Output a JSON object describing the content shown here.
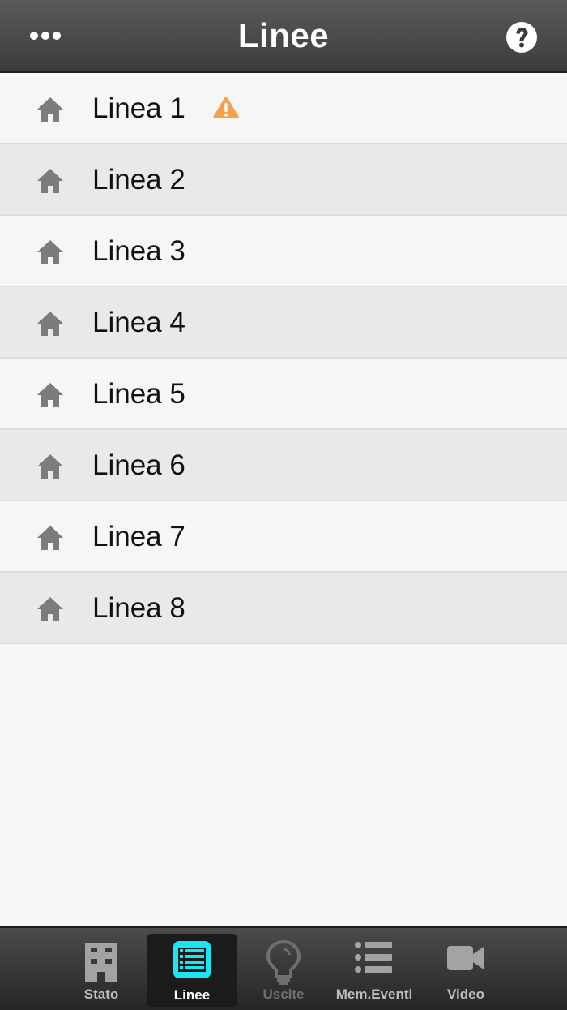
{
  "header": {
    "title": "Linee",
    "menu_icon": "more-icon",
    "help_icon": "help-icon"
  },
  "lines": [
    {
      "label": "Linea 1",
      "icon": "home-icon",
      "alert": true
    },
    {
      "label": "Linea 2",
      "icon": "home-icon",
      "alert": false
    },
    {
      "label": "Linea 3",
      "icon": "home-icon",
      "alert": false
    },
    {
      "label": "Linea 4",
      "icon": "home-icon",
      "alert": false
    },
    {
      "label": "Linea 5",
      "icon": "home-icon",
      "alert": false
    },
    {
      "label": "Linea 6",
      "icon": "home-icon",
      "alert": false
    },
    {
      "label": "Linea 7",
      "icon": "home-icon",
      "alert": false
    },
    {
      "label": "Linea 8",
      "icon": "home-icon",
      "alert": false
    }
  ],
  "tabs": [
    {
      "label": "Stato",
      "icon": "building-icon",
      "state": "normal"
    },
    {
      "label": "Linee",
      "icon": "list-icon",
      "state": "active"
    },
    {
      "label": "Uscite",
      "icon": "lightbulb-icon",
      "state": "disabled"
    },
    {
      "label": "Mem.Eventi",
      "icon": "event-list-icon",
      "state": "normal"
    },
    {
      "label": "Video",
      "icon": "video-camera-icon",
      "state": "normal"
    }
  ],
  "colors": {
    "header_bg": "#4a4a4a",
    "row_odd": "#f6f6f6",
    "row_even": "#e9e9e9",
    "icon_gray": "#7c7c7c",
    "warning": "#f5a04a",
    "active_tab_accent": "#19e6f0"
  }
}
